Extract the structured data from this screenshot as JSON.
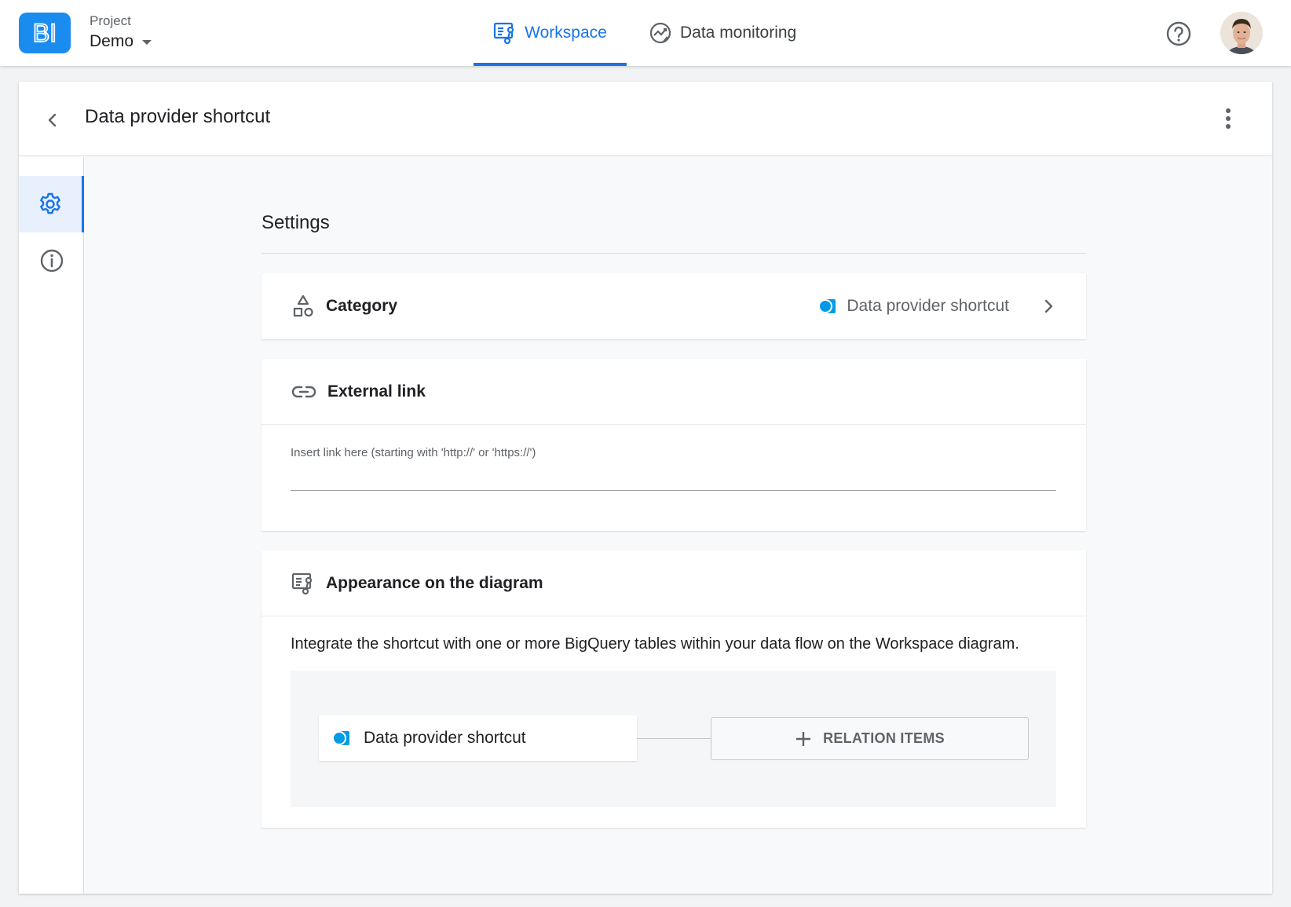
{
  "app": {
    "logo_text": "BI",
    "project_label": "Project",
    "project_name": "Demo"
  },
  "nav": {
    "tabs": [
      {
        "label": "Workspace",
        "icon": "workspace-diagram-icon",
        "active": true
      },
      {
        "label": "Data monitoring",
        "icon": "monitoring-chart-icon",
        "active": false
      }
    ]
  },
  "header": {
    "help_icon": "help-circle-icon",
    "avatar_icon": "user-avatar"
  },
  "page": {
    "title": "Data provider shortcut",
    "back_icon": "chevron-left-icon",
    "more_icon": "more-vertical-icon"
  },
  "rail": {
    "items": [
      {
        "name": "settings",
        "icon": "gear-icon",
        "active": true
      },
      {
        "name": "info",
        "icon": "info-icon",
        "active": false
      }
    ]
  },
  "settings": {
    "title": "Settings",
    "category": {
      "label": "Category",
      "value": "Data provider shortcut",
      "icon": "shapes-icon"
    },
    "external_link": {
      "label": "External link",
      "placeholder": "Insert link here (starting with 'http://' or 'https://')",
      "value": "",
      "icon": "link-icon"
    },
    "appearance": {
      "label": "Appearance on the diagram",
      "description": "Integrate the shortcut with one or more BigQuery tables within your data flow on the Workspace diagram.",
      "node_label": "Data provider shortcut",
      "relation_button": "RELATION ITEMS",
      "icon": "workspace-diagram-icon"
    }
  },
  "colors": {
    "accent": "#1a73e8",
    "logo_bg": "#1a8cf0",
    "data_provider": "#039be5"
  }
}
